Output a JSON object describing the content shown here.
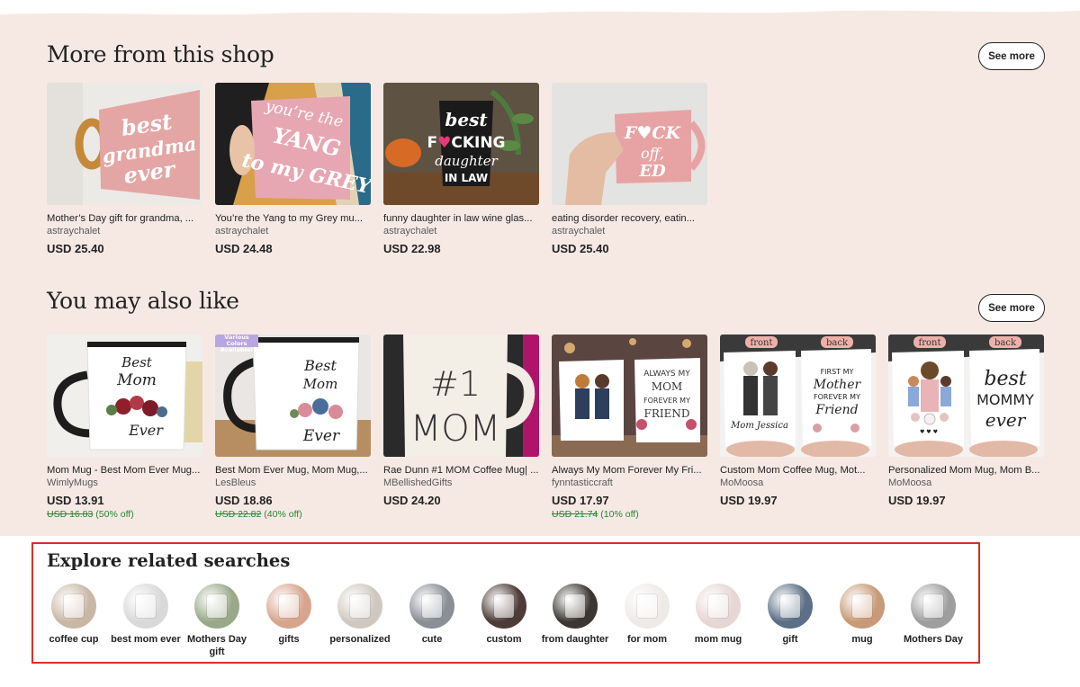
{
  "section1": {
    "title": "More from this shop",
    "see_more": "See more",
    "items": [
      {
        "title": "Mother’s Day gift for grandma, ...",
        "shop": "astraychalet",
        "price": "USD 25.40",
        "image_text": "best grandma ever"
      },
      {
        "title": "You’re the Yang to my Grey mu...",
        "shop": "astraychalet",
        "price": "USD 24.48",
        "image_text": "you’re the YANG to my GREY"
      },
      {
        "title": "funny daughter in law wine glas...",
        "shop": "astraychalet",
        "price": "USD 22.98",
        "image_text": "best f♥CKING daughter in LAW"
      },
      {
        "title": "eating disorder recovery, eatin...",
        "shop": "astraychalet",
        "price": "USD 25.40",
        "image_text": "F♥CK off ED"
      }
    ]
  },
  "section2": {
    "title": "You may also like",
    "see_more": "See more",
    "items": [
      {
        "title": "Mom Mug - Best Mom Ever Mug...",
        "shop": "WimlyMugs",
        "price": "USD 13.91",
        "original_price": "USD 16.83",
        "discount": "(50% off)",
        "image_text": "Best Mom Ever"
      },
      {
        "title": "Best Mom Ever Mug, Mom Mug,...",
        "shop": "LesBleus",
        "price": "USD 18.86",
        "original_price": "USD 22.82",
        "discount": "(40% off)",
        "image_text": "Best Mom Ever",
        "badge": "Various Colors Available!"
      },
      {
        "title": "Rae Dunn #1 MOM Coffee Mug| ...",
        "shop": "MBellishedGifts",
        "price": "USD 24.20",
        "image_text": "#1 MOM"
      },
      {
        "title": "Always My Mom Forever My Fri...",
        "shop": "fynntasticcraft",
        "price": "USD 17.97",
        "original_price": "USD 21.74",
        "discount": "(10% off)",
        "image_text": "ALWAYS MY MOM FOREVER MY FRIEND"
      },
      {
        "title": "Custom Mom Coffee Mug, Mot...",
        "shop": "MoMoosa",
        "price": "USD 19.97",
        "image_text": "FIRST MY Mother FOREVER MY Friend",
        "tag_front": "front",
        "tag_back": "back"
      },
      {
        "title": "Personalized Mom Mug, Mom B...",
        "shop": "MoMoosa",
        "price": "USD 19.97",
        "image_text": "best MOMMY ever",
        "tag_front": "front",
        "tag_back": "back"
      }
    ]
  },
  "explore": {
    "title": "Explore related searches",
    "chips": [
      {
        "label": "coffee cup",
        "color": "#c9b7a6"
      },
      {
        "label": "best mom ever",
        "color": "#d9d9d9"
      },
      {
        "label": "Mothers Day gift",
        "color": "#9aa88a"
      },
      {
        "label": "gifts",
        "color": "#d7a58e"
      },
      {
        "label": "personalized",
        "color": "#cfc8c0"
      },
      {
        "label": "cute",
        "color": "#8a8f96"
      },
      {
        "label": "custom",
        "color": "#4c3b37"
      },
      {
        "label": "from daughter",
        "color": "#3b3631"
      },
      {
        "label": "for mom",
        "color": "#eeeae8"
      },
      {
        "label": "mom mug",
        "color": "#e6d6d4"
      },
      {
        "label": "gift",
        "color": "#5c6f86"
      },
      {
        "label": "mug",
        "color": "#c89a78"
      },
      {
        "label": "Mothers Day",
        "color": "#9e9e9e"
      }
    ]
  }
}
